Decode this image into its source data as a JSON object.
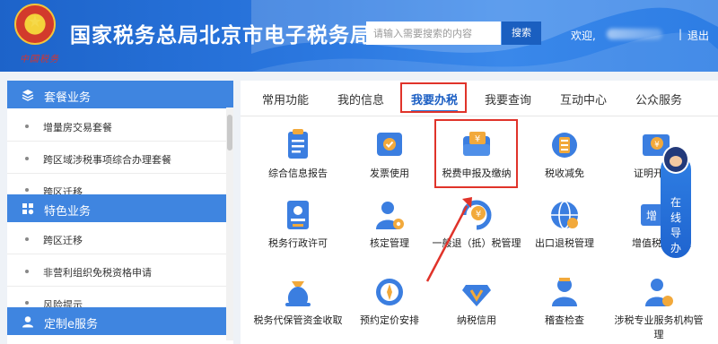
{
  "header": {
    "site_title": "国家税务总局北京市电子税务局",
    "emblem_caption": "中国税务",
    "search_placeholder": "请输入需要搜索的内容",
    "search_label": "搜索",
    "welcome": "欢迎,",
    "separator": "|",
    "logout": "退出"
  },
  "sidebar": {
    "sections": [
      {
        "title": "套餐业务",
        "icon": "layers-icon",
        "items": [
          "增量房交易套餐",
          "跨区域涉税事项综合办理套餐",
          "跨区迁移"
        ]
      },
      {
        "title": "特色业务",
        "icon": "grid-icon",
        "items": [
          "跨区迁移",
          "非营利组织免税资格申请",
          "风险提示"
        ]
      },
      {
        "title": "定制e服务",
        "icon": "user-icon",
        "items": []
      }
    ]
  },
  "main": {
    "tabs": [
      "常用功能",
      "我的信息",
      "我要办税",
      "我要查询",
      "互动中心",
      "公众服务"
    ],
    "active_tab": "我要办税",
    "tiles": [
      {
        "label": "综合信息报告",
        "icon": "report-icon"
      },
      {
        "label": "发票使用",
        "icon": "invoice-icon"
      },
      {
        "label": "税费申报及缴纳",
        "icon": "wallet-icon"
      },
      {
        "label": "税收减免",
        "icon": "coin-stack-icon"
      },
      {
        "label": "证明开",
        "icon": "certificate-icon"
      },
      {
        "label": "税务行政许可",
        "icon": "license-icon"
      },
      {
        "label": "核定管理",
        "icon": "user-settings-icon"
      },
      {
        "label": "一般退（抵）税管理",
        "icon": "refund-icon"
      },
      {
        "label": "出口退税管理",
        "icon": "globe-icon"
      },
      {
        "label": "增值税抵管理",
        "icon": "ticket-icon"
      },
      {
        "label": "税务代保管资金收取",
        "icon": "money-bag-icon"
      },
      {
        "label": "预约定价安排",
        "icon": "compass-icon"
      },
      {
        "label": "纳税信用",
        "icon": "diamond-icon"
      },
      {
        "label": "稽查检查",
        "icon": "inspector-icon"
      },
      {
        "label": "涉税专业服务机构管理",
        "icon": "agency-icon"
      }
    ]
  },
  "guide": {
    "label": "在线导办"
  },
  "colors": {
    "header_blue": "#2b78e0",
    "sidebar_head": "#3f85e0",
    "highlight_red": "#e0332a",
    "icon_blue": "#3b7ee0",
    "icon_orange": "#f2a93b"
  }
}
